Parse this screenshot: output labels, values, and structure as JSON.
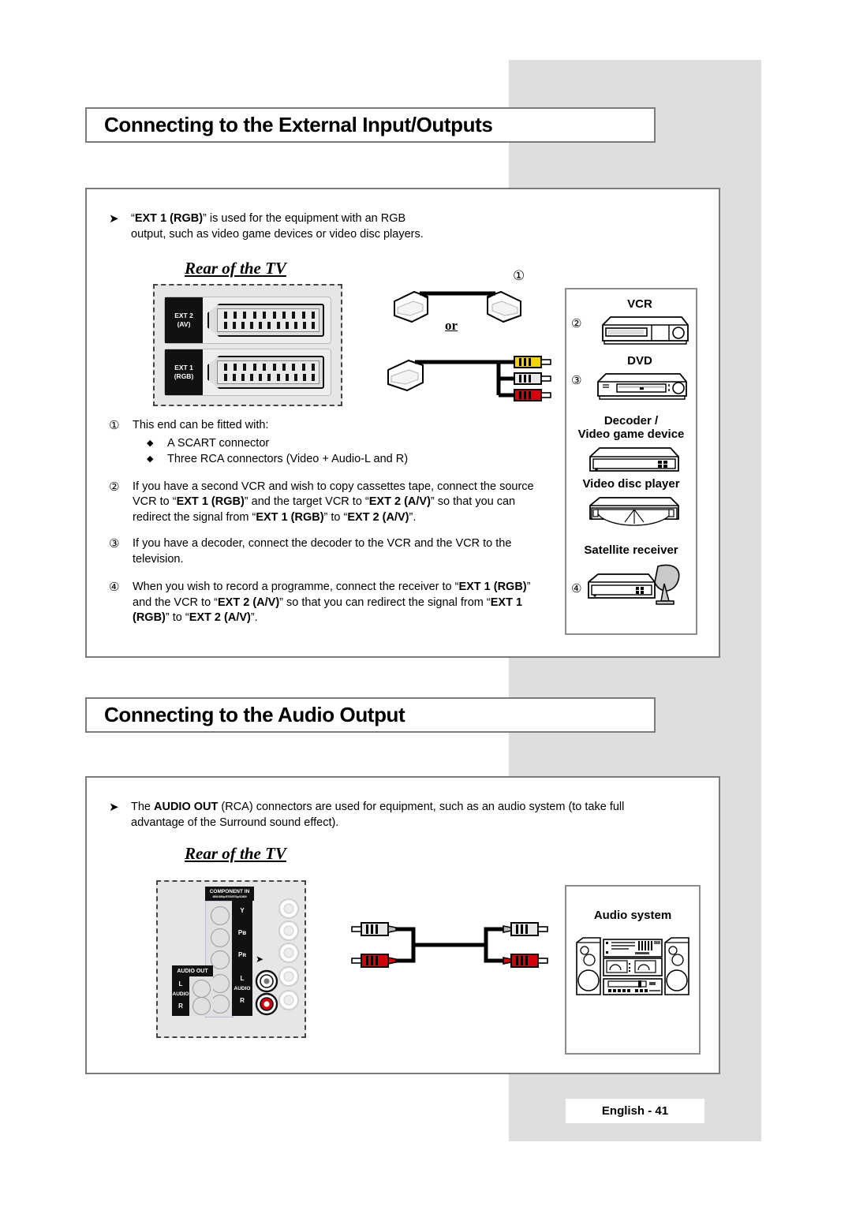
{
  "sections": {
    "external_io": {
      "title": "Connecting to the External Input/Outputs",
      "note": "“EXT 1 (RGB)” is used for the equipment with an RGB output, such as video game devices or video disc players.",
      "note_bold": "EXT 1 (RGB)",
      "rear_caption": "Rear of the TV",
      "or_label": "or",
      "marker_1": "①",
      "items": [
        {
          "num": "①",
          "text": "This end can be fitted with:",
          "subitems": [
            {
              "bullet": "◆",
              "text": "A SCART connector"
            },
            {
              "bullet": "◆",
              "text": "Three RCA connectors (Video + Audio-L and R)"
            }
          ]
        },
        {
          "num": "②",
          "text": "If you have a second VCR and wish to copy cassettes tape, connect the source VCR to “EXT 1 (RGB)” and the target VCR to “EXT 2 (A/V)” so that you can redirect the signal from “EXT 1 (RGB)” to “EXT 2 (A/V)”."
        },
        {
          "num": "③",
          "text": "If you have a decoder, connect the decoder to the VCR and the VCR to the television."
        },
        {
          "num": "④",
          "text": "When you wish to record a programme, connect the receiver to “EXT 1 (RGB)” and the VCR to “EXT 2 (A/V)” so that you can redirect the signal from “EXT 1 (RGB)” to “EXT 2 (A/V)”."
        }
      ],
      "tv_ports": [
        {
          "name": "EXT 2",
          "sub": "(AV)"
        },
        {
          "name": "EXT 1",
          "sub": "(RGB)"
        }
      ],
      "devices": [
        {
          "label": "VCR",
          "num": "②"
        },
        {
          "label": "DVD",
          "num": "③"
        },
        {
          "label": "Decoder /",
          "label2": "Video game device",
          "num": ""
        },
        {
          "label": "Video disc player",
          "num": ""
        },
        {
          "label": "Satellite receiver",
          "num": "④"
        }
      ],
      "rca_colors": {
        "video": "#f2d300",
        "audio_left": "#e8e8e8",
        "audio_right": "#d3000c"
      }
    },
    "audio_output": {
      "title": "Connecting to the Audio Output",
      "note": "The AUDIO OUT (RCA) connectors are used for equipment, such as an audio system (to take full advantage of the Surround sound effect).",
      "note_bold": "AUDIO OUT",
      "rear_caption": "Rear of the TV",
      "panel_labels": {
        "component_in": "COMPONENT IN",
        "component_sub": "480i/480p/576i/576p/1080i",
        "audio_out": "AUDIO OUT",
        "jack_y": "Y",
        "jack_pb": "Pʙ",
        "jack_pr": "Pʀ",
        "jack_l": "L",
        "jack_audio": "AUDIO",
        "jack_r": "R"
      },
      "audio_system_label": "Audio system",
      "rca_colors": {
        "left": "#e8e8e8",
        "right": "#d3000c"
      }
    }
  },
  "footer": {
    "page_label": "English - 41"
  },
  "theme": {
    "grey_band": "#dedede",
    "box_border": "#7b7b7b",
    "panel_bg": "#e6e6e6",
    "ink": "#000000"
  }
}
